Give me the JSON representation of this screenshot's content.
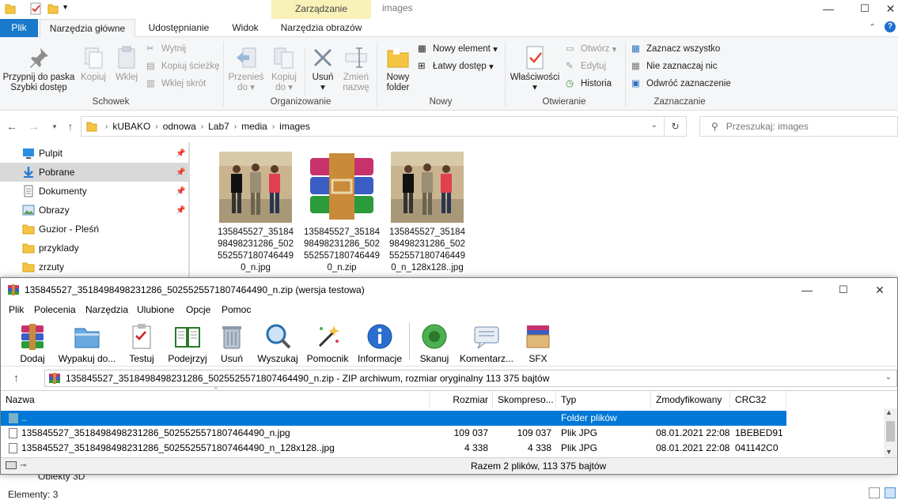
{
  "explorer": {
    "context_tab": "Zarządzanie",
    "window_title": "images",
    "tabs": [
      "Plik",
      "Narzędzia główne",
      "Udostępnianie",
      "Widok",
      "Narzędzia obrazów"
    ],
    "ribbon": {
      "clipboard": {
        "pin_label_1": "Przypnij do paska",
        "pin_label_2": "Szybki dostęp",
        "copy": "Kopiuj",
        "paste": "Wklej",
        "cut": "Wytnij",
        "copy_path": "Kopiuj ścieżkę",
        "paste_shortcut": "Wklej skrót",
        "group": "Schowek"
      },
      "organize": {
        "move_1": "Przenieś",
        "move_2": "do",
        "copy_1": "Kopiuj",
        "copy_2": "do",
        "delete": "Usuń",
        "rename_1": "Zmień",
        "rename_2": "nazwę",
        "group": "Organizowanie"
      },
      "new": {
        "folder_1": "Nowy",
        "folder_2": "folder",
        "new_item": "Nowy element",
        "easy_access": "Łatwy dostęp",
        "group": "Nowy"
      },
      "open": {
        "properties": "Właściwości",
        "open": "Otwórz",
        "edit": "Edytuj",
        "history": "Historia",
        "group": "Otwieranie"
      },
      "select": {
        "select_all": "Zaznacz wszystko",
        "select_none": "Nie zaznaczaj nic",
        "invert": "Odwróć zaznaczenie",
        "group": "Zaznaczanie"
      }
    },
    "breadcrumb": [
      "kUBAKO",
      "odnowa",
      "Lab7",
      "media",
      "images"
    ],
    "search_placeholder": "Przeszukaj: images",
    "nav_items": [
      {
        "label": "Pulpit",
        "icon": "desktop-icon",
        "pinned": true
      },
      {
        "label": "Pobrane",
        "icon": "download-icon",
        "pinned": true
      },
      {
        "label": "Dokumenty",
        "icon": "documents-icon",
        "pinned": true
      },
      {
        "label": "Obrazy",
        "icon": "pictures-icon",
        "pinned": true
      },
      {
        "label": "Guzior - Pleśń",
        "icon": "folder-icon",
        "pinned": false
      },
      {
        "label": "przyklady",
        "icon": "folder-icon",
        "pinned": false
      },
      {
        "label": "zrzuty",
        "icon": "folder-icon",
        "pinned": false
      }
    ],
    "files": [
      {
        "name": "135845527_3518498498231286_5025525571807464490_n.jpg",
        "lines": [
          "135845527_35184",
          "98498231286_502",
          "552557180746449",
          "0_n.jpg"
        ],
        "type": "photo"
      },
      {
        "name": "135845527_3518498498231286_5025525571807464490_n.zip",
        "lines": [
          "135845527_35184",
          "98498231286_502",
          "552557180746449",
          "0_n.zip"
        ],
        "type": "archive"
      },
      {
        "name": "135845527_3518498498231286_5025525571807464490_n_128x128..jpg",
        "lines": [
          "135845527_35184",
          "98498231286_502",
          "552557180746449",
          "0_n_128x128..jpg"
        ],
        "type": "photo"
      }
    ],
    "hidden_nav_item": "Obiekty 3D",
    "status": "Elementy: 3"
  },
  "winrar": {
    "title": "135845527_3518498498231286_5025525571807464490_n.zip (wersja testowa)",
    "menu": [
      "Plik",
      "Polecenia",
      "Narzędzia",
      "Ulubione",
      "Opcje",
      "Pomoc"
    ],
    "toolbar": [
      "Dodaj",
      "Wypakuj do...",
      "Testuj",
      "Podejrzyj",
      "Usuń",
      "Wyszukaj",
      "Pomocnik",
      "Informacje",
      "Skanuj",
      "Komentarz...",
      "SFX"
    ],
    "path": "135845527_3518498498231286_5025525571807464490_n.zip - ZIP archiwum, rozmiar oryginalny 113 375 bajtów",
    "columns": [
      "Nazwa",
      "Rozmiar",
      "Skompreso...",
      "Typ",
      "Zmodyfikowany",
      "CRC32"
    ],
    "rows": [
      {
        "name": "..",
        "size": "",
        "packed": "",
        "type": "Folder plików",
        "modified": "",
        "crc": ""
      },
      {
        "name": "135845527_3518498498231286_5025525571807464490_n.jpg",
        "size": "109 037",
        "packed": "109 037",
        "type": "Plik JPG",
        "modified": "08.01.2021 22:08",
        "crc": "1BEBED91"
      },
      {
        "name": "135845527_3518498498231286_5025525571807464490_n_128x128..jpg",
        "size": "4 338",
        "packed": "4 338",
        "type": "Plik JPG",
        "modified": "08.01.2021 22:08",
        "crc": "041142C0"
      }
    ],
    "status": "Razem 2 plików, 113 375 bajtów"
  }
}
